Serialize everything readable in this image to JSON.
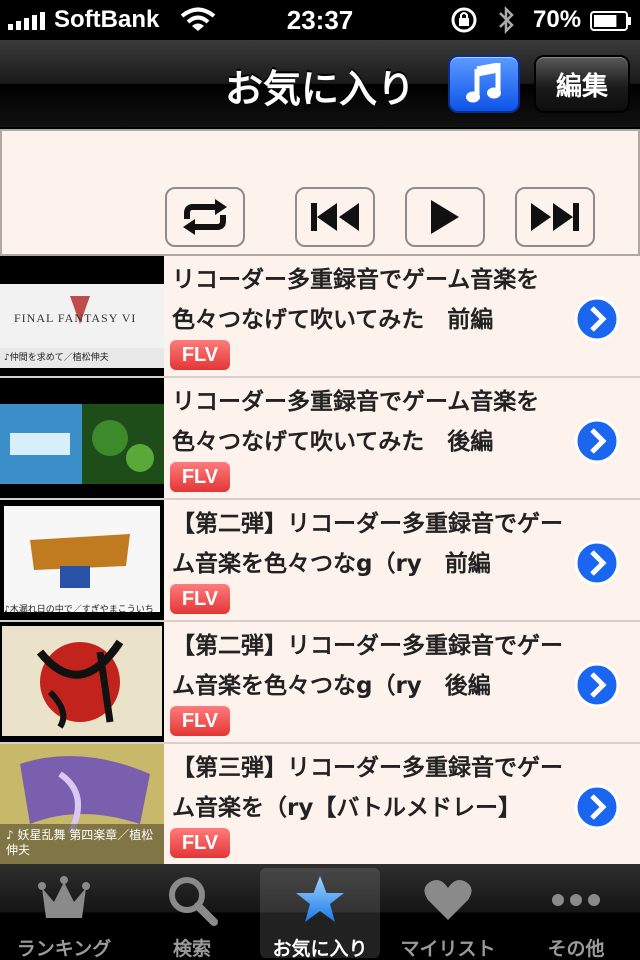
{
  "status_bar": {
    "carrier": "SoftBank",
    "time": "23:37",
    "battery_percent": "70%",
    "battery_level": 0.7
  },
  "nav": {
    "title": "お気に入り",
    "music_icon": "music-note-icon",
    "edit_label": "編集"
  },
  "player": {
    "controls": [
      "repeat-icon",
      "previous-icon",
      "play-icon",
      "next-icon"
    ]
  },
  "list": {
    "items": [
      {
        "title": "リコーダー多重録音でゲーム音楽を色々つなげて吹いてみた　前編",
        "badge": "FLV",
        "thumb_caption": "♪仲間を求めて／植松伸夫",
        "thumb_logo": "FINAL FANTASY VI"
      },
      {
        "title": "リコーダー多重録音でゲーム音楽を色々つなげて吹いてみた　後編",
        "badge": "FLV",
        "thumb_caption": "",
        "thumb_logo": ""
      },
      {
        "title": "【第二弾】リコーダー多重録音でゲーム音楽を色々つなg（ry　前編",
        "badge": "FLV",
        "thumb_caption": "♪木漏れ日の中で／すぎやまこういち",
        "thumb_logo": ""
      },
      {
        "title": "【第二弾】リコーダー多重録音でゲーム音楽を色々つなg（ry　後編",
        "badge": "FLV",
        "thumb_caption": "",
        "thumb_logo": ""
      },
      {
        "title": "【第三弾】リコーダー多重録音でゲーム音楽を（ry【バトルメドレー】",
        "badge": "FLV",
        "thumb_caption": "♪ 妖星乱舞 第四楽章／植松伸夫",
        "thumb_logo": ""
      }
    ]
  },
  "tab_bar": {
    "tabs": [
      {
        "label": "ランキング",
        "icon": "crown-icon",
        "active": false
      },
      {
        "label": "検索",
        "icon": "search-icon",
        "active": false
      },
      {
        "label": "お気に入り",
        "icon": "star-icon",
        "active": true
      },
      {
        "label": "マイリスト",
        "icon": "heart-icon",
        "active": false
      },
      {
        "label": "その他",
        "icon": "more-icon",
        "active": false
      }
    ]
  },
  "colors": {
    "accent_blue": "#1a66f0",
    "badge_red": "#e33636",
    "list_background": "#fdf3ec"
  }
}
